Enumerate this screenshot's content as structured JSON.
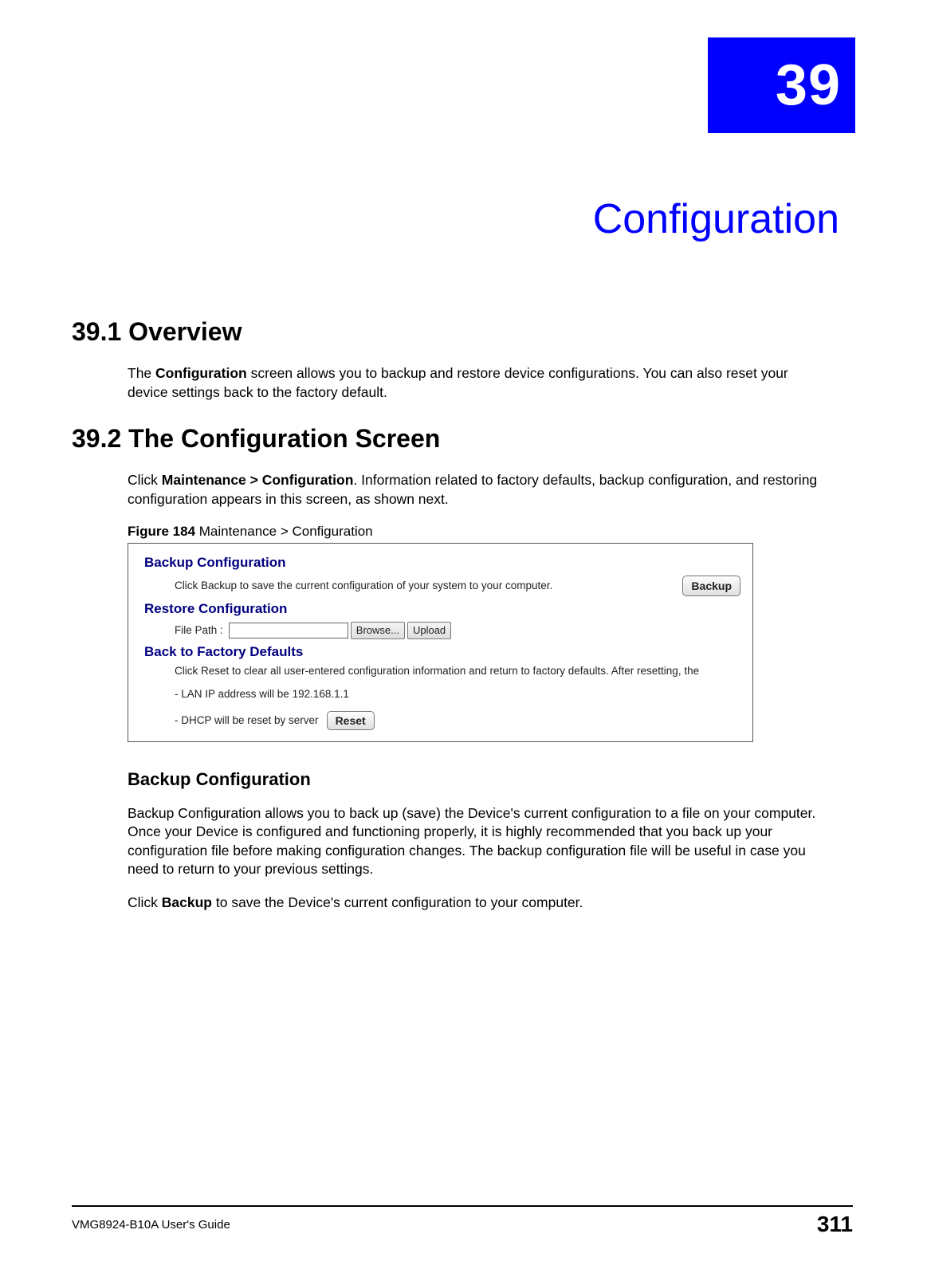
{
  "chapter": {
    "number": "39",
    "title": "Configuration"
  },
  "section1": {
    "heading": "39.1  Overview",
    "para_pre": "The ",
    "para_bold": "Configuration",
    "para_post": " screen allows you to backup and restore device configurations. You can also reset your device settings back to the factory default."
  },
  "section2": {
    "heading": "39.2  The Configuration Screen",
    "para_pre": "Click ",
    "para_bold": "Maintenance > Configuration",
    "para_post": ". Information related to factory defaults, backup configuration, and restoring configuration appears in this screen, as shown next.",
    "figure_label": "Figure 184",
    "figure_title": "   Maintenance >  Configuration"
  },
  "figure": {
    "backup_title": "Backup Configuration",
    "backup_text": "Click Backup to save the current configuration of your system to your computer.",
    "backup_btn": "Backup",
    "restore_title": "Restore Configuration",
    "restore_label": "File Path :",
    "browse_btn": "Browse...",
    "upload_btn": "Upload",
    "defaults_title": "Back to Factory Defaults",
    "defaults_text": "Click Reset to clear all user-entered configuration information and return to factory defaults. After resetting, the",
    "bullet1": "- LAN IP address will be 192.168.1.1",
    "bullet2": "- DHCP will be reset by server",
    "reset_btn": "Reset"
  },
  "sub": {
    "heading": "Backup Configuration",
    "para1": "Backup Configuration allows you to back up (save) the Device's current configuration to a file on your computer. Once your Device is configured and functioning properly, it is highly recommended that you back up your configuration file before making configuration changes. The backup configuration file will be useful in case you need to return to your previous settings.",
    "para2_pre": "Click ",
    "para2_bold": "Backup",
    "para2_post": " to save the Device's current configuration to your computer."
  },
  "footer": {
    "guide": "VMG8924-B10A User's Guide",
    "page": "311"
  }
}
